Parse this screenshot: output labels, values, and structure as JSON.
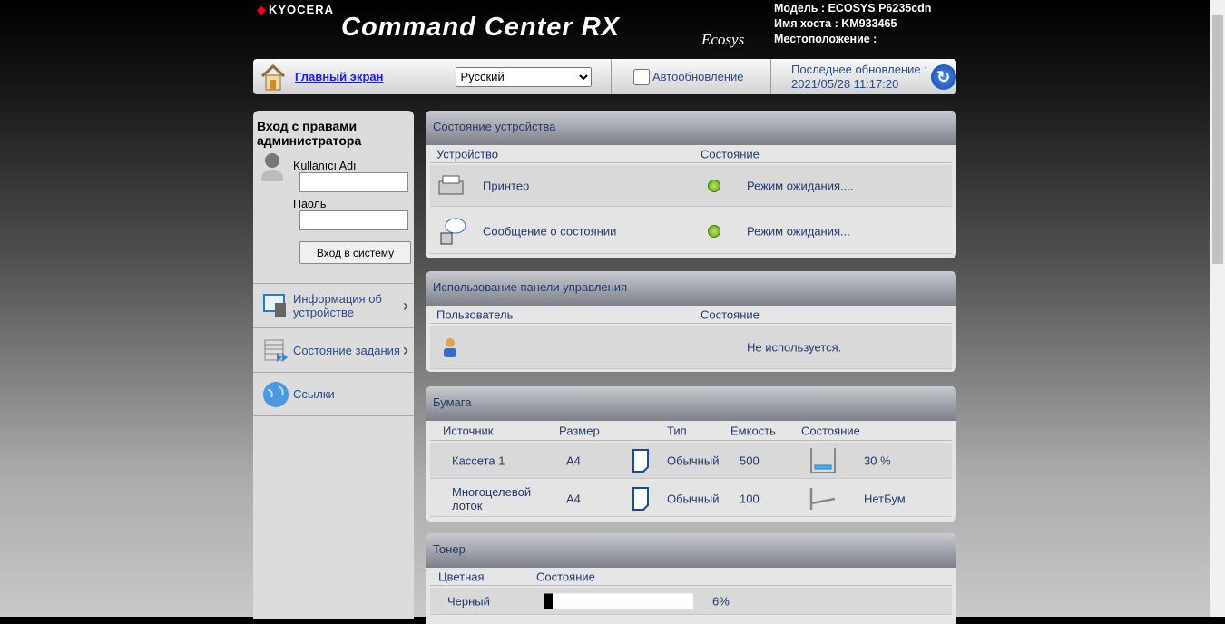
{
  "header": {
    "brand": "KYOCERA",
    "product": "Command Center RX",
    "ecosys": "Ecosys",
    "model": "Модель : ECOSYS P6235cdn",
    "host": "Имя хоста : KM933465",
    "location": "Местоположение :"
  },
  "toolbar": {
    "home": "Главный экран",
    "language": "Русский",
    "auto_refresh": "Автообновление",
    "last_update_label": "Последнее обновление :",
    "last_update": "2021/05/28 11:17:20"
  },
  "sidebar": {
    "login_title": "Вход с правами администратора",
    "username_label": "Kullanıcı Adı",
    "username_value": "",
    "password_label": "Паоль",
    "password_value": "",
    "login_button": "Вход в систему",
    "items": [
      {
        "label": "Информация об устройстве"
      },
      {
        "label": "Состояние задания"
      },
      {
        "label": "Ссылки"
      }
    ]
  },
  "device_status": {
    "title": "Состояние устройства",
    "col_device": "Устройство",
    "col_status": "Состояние",
    "rows": [
      {
        "name": "Принтер",
        "status": "Режим ожидания...."
      },
      {
        "name": "Сообщение о состоянии",
        "status": "Режим ожидания..."
      }
    ]
  },
  "panel_usage": {
    "title": "Использование панели управления",
    "col_user": "Пользователь",
    "col_status": "Состояние",
    "status": "Не используется."
  },
  "paper": {
    "title": "Бумага",
    "cols": [
      "Источник",
      "Размер",
      "Тип",
      "Емкость",
      "Состояние"
    ],
    "rows": [
      {
        "source": "Кассета 1",
        "size": "A4",
        "type": "Обычный",
        "capacity": "500",
        "status": "30 %",
        "level": 30
      },
      {
        "source": "Многоцелевой лоток",
        "size": "A4",
        "type": "Обычный",
        "capacity": "100",
        "status": "НетБум",
        "level": 0
      }
    ]
  },
  "toner": {
    "title": "Тонер",
    "col_color": "Цветная",
    "col_status": "Состояние",
    "rows": [
      {
        "color": "Черный",
        "percent": "6%",
        "level": 6
      }
    ]
  },
  "colors": {
    "status_ok": "#5ea010",
    "link": "#1a1aff",
    "text": "#223a6e"
  }
}
